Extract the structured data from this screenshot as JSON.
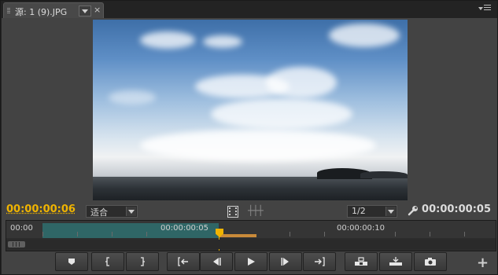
{
  "panel": {
    "tab_label": "源: 1 (9).JPG",
    "close_glyph": "×",
    "menu_icon": "panel-menu-icon"
  },
  "monitor": {
    "current_timecode": "00:00:00:06",
    "duration_timecode": "00:00:00:05",
    "zoom_value": "适合",
    "resolution_value": "1/2",
    "accent_color": "#f0b400"
  },
  "timeline": {
    "ruler_labels": [
      "00:00",
      "00:00:00:05",
      "00:00:00:10"
    ],
    "playhead_position_fraction": 0.43
  },
  "transport": {
    "buttons": [
      {
        "name": "add-marker-button",
        "icon": "marker-icon"
      },
      {
        "name": "mark-in-button",
        "icon": "mark-in-icon"
      },
      {
        "name": "mark-out-button",
        "icon": "mark-out-icon"
      },
      {
        "name": "go-to-in-button",
        "icon": "go-to-in-icon"
      },
      {
        "name": "step-back-button",
        "icon": "step-back-icon"
      },
      {
        "name": "play-stop-button",
        "icon": "play-icon"
      },
      {
        "name": "step-forward-button",
        "icon": "step-forward-icon"
      },
      {
        "name": "go-to-out-button",
        "icon": "go-to-out-icon"
      },
      {
        "name": "insert-button",
        "icon": "insert-icon"
      },
      {
        "name": "overwrite-button",
        "icon": "overwrite-icon"
      },
      {
        "name": "export-frame-button",
        "icon": "camera-icon"
      }
    ],
    "add_glyph": "+"
  }
}
